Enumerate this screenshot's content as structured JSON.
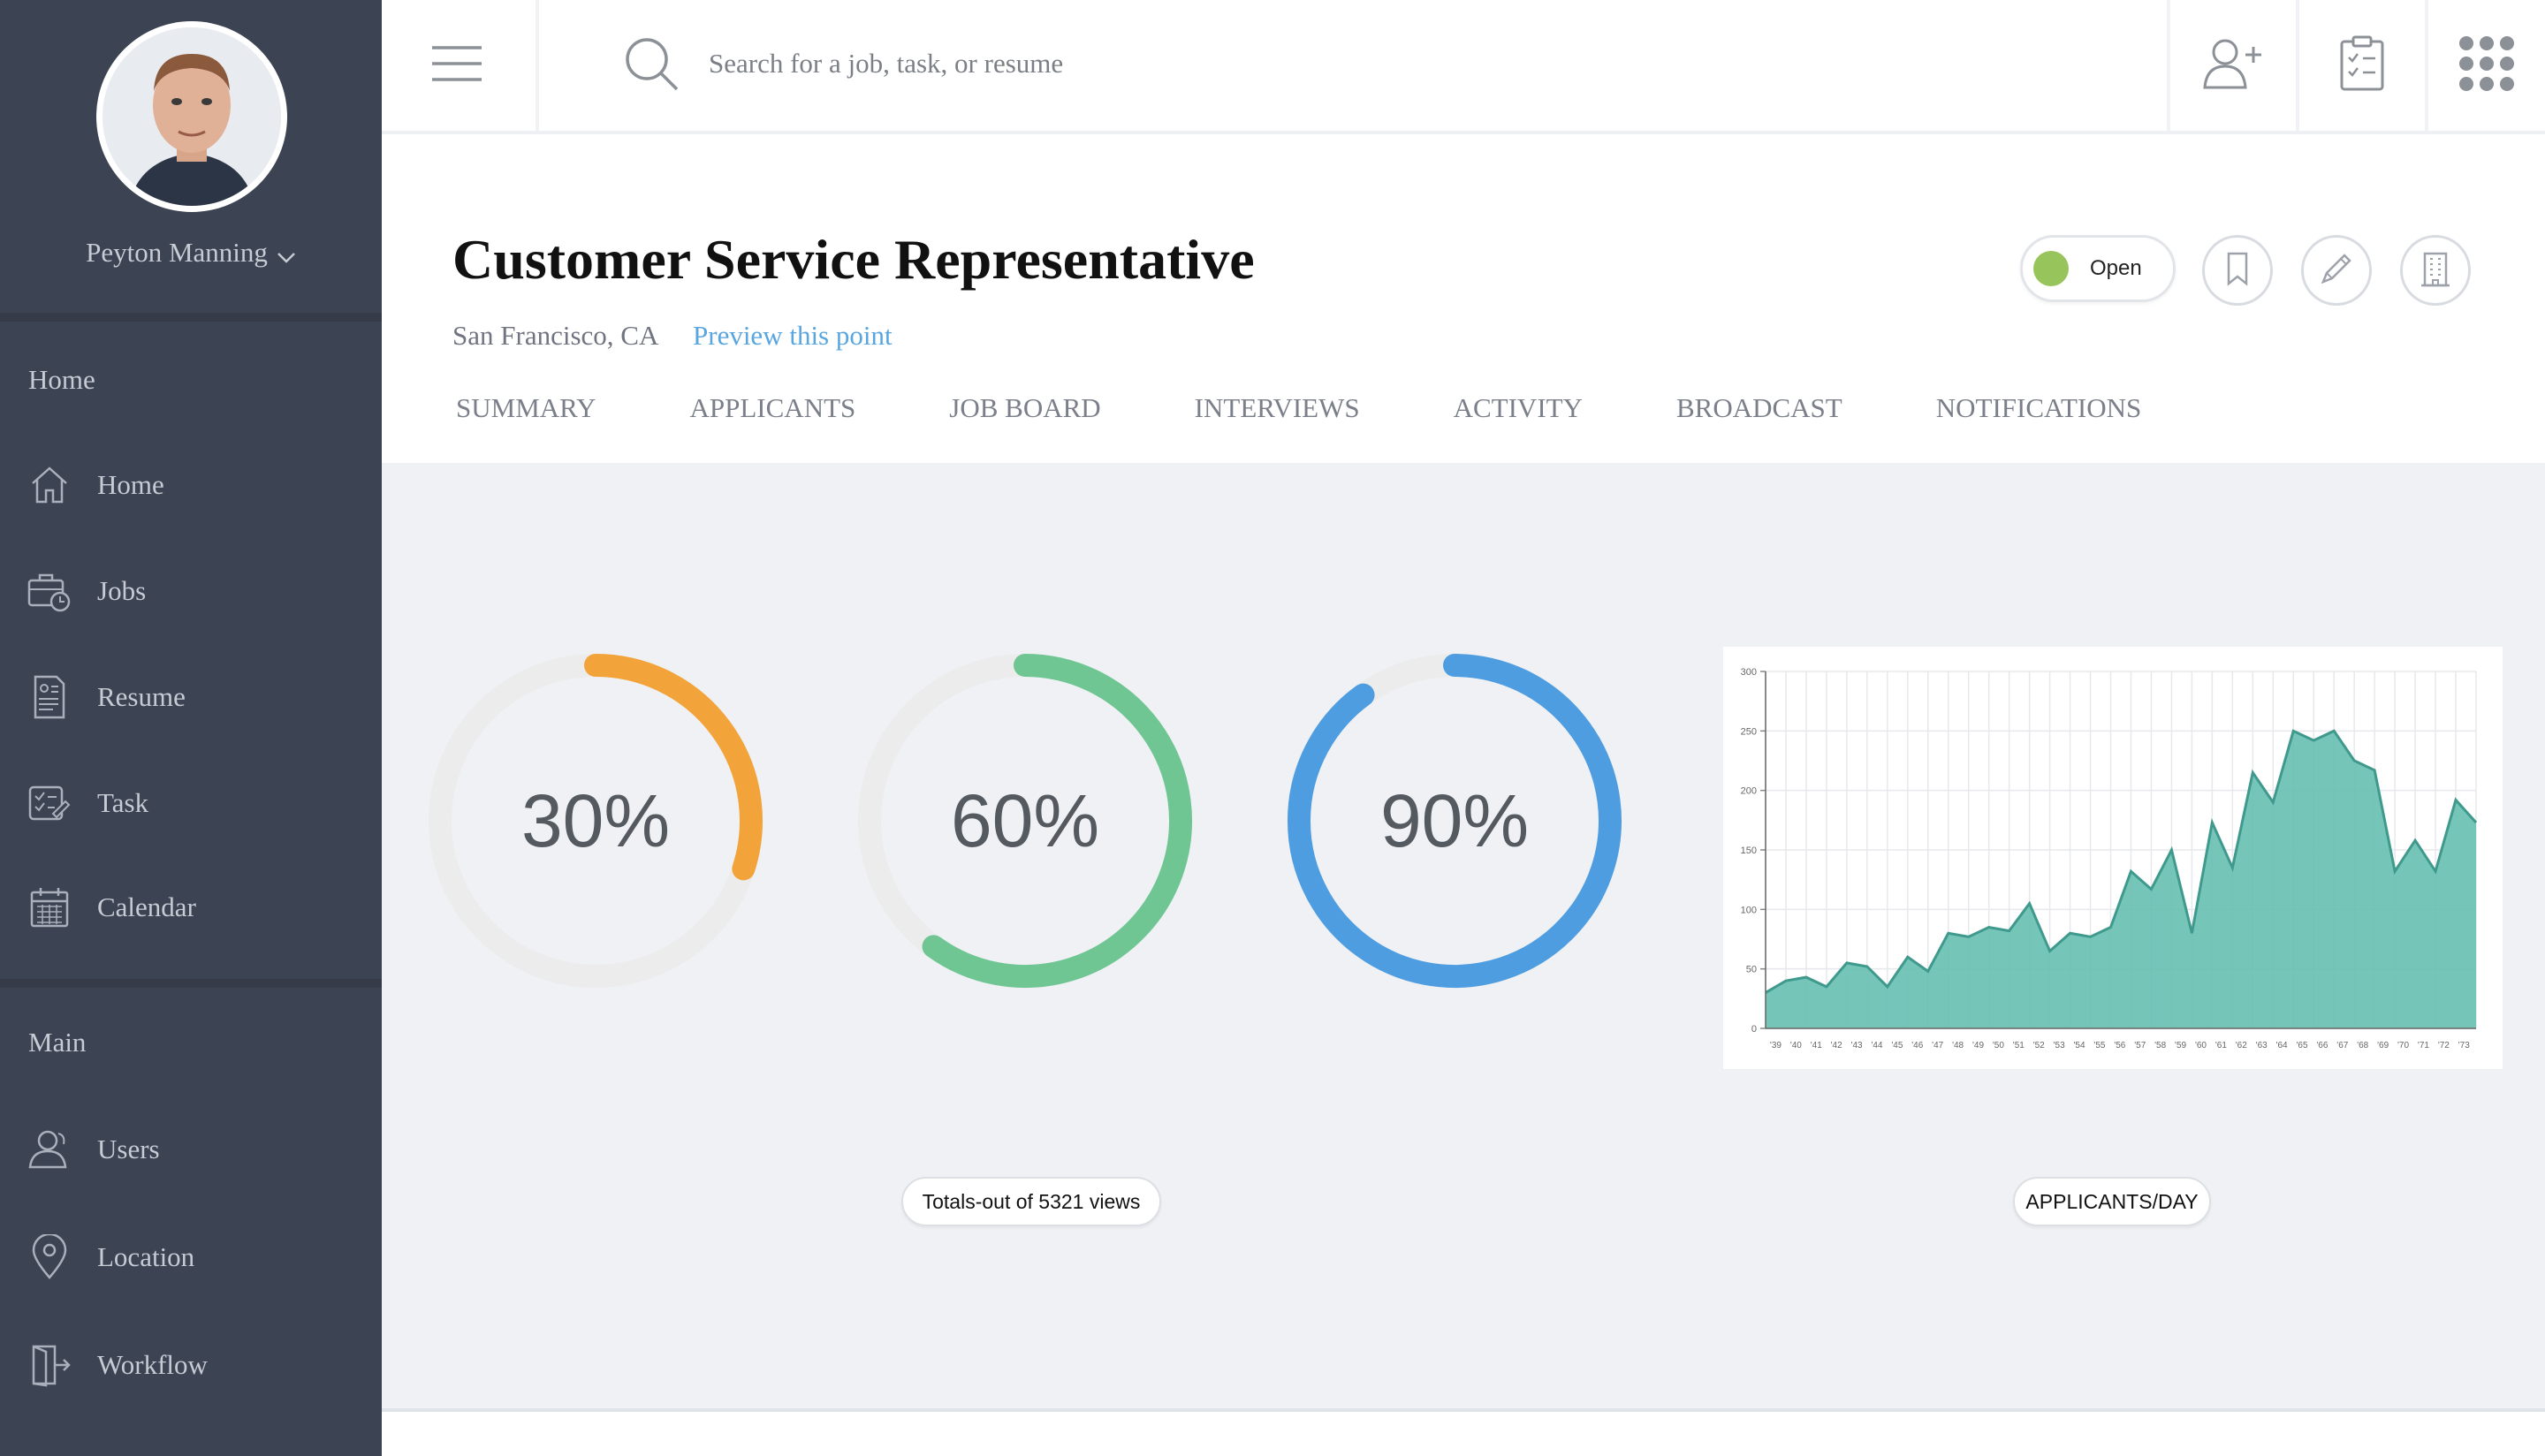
{
  "sidebar": {
    "user_name": "Peyton Manning",
    "sections": [
      {
        "title": "Home",
        "items": [
          {
            "label": "Home",
            "icon": "home-icon"
          },
          {
            "label": "Jobs",
            "icon": "briefcase-clock-icon"
          },
          {
            "label": "Resume",
            "icon": "resume-icon"
          },
          {
            "label": "Task",
            "icon": "task-icon"
          },
          {
            "label": "Calendar",
            "icon": "calendar-icon"
          }
        ]
      },
      {
        "title": "Main",
        "items": [
          {
            "label": "Users",
            "icon": "users-icon"
          },
          {
            "label": "Location",
            "icon": "location-pin-icon"
          },
          {
            "label": "Workflow",
            "icon": "workflow-icon"
          }
        ]
      }
    ]
  },
  "topbar": {
    "search_placeholder": "Search for a job, task, or resume",
    "icons": [
      "menu-icon",
      "search-icon",
      "add-user-icon",
      "clipboard-check-icon",
      "apps-grid-icon"
    ]
  },
  "job": {
    "title": "Customer Service Representative",
    "location": "San Francisco, CA",
    "preview_link": "Preview this point",
    "status": "Open",
    "status_color": "#98c55b",
    "action_icons": [
      "bookmark-icon",
      "pencil-icon",
      "building-icon"
    ]
  },
  "tabs": [
    "SUMMARY",
    "APPLICANTS",
    "JOB BOARD",
    "INTERVIEWS",
    "ACTIVITY",
    "BROADCAST",
    "NOTIFICATIONS"
  ],
  "stats": {
    "donuts": [
      {
        "label": "30%",
        "value": 30,
        "color": "#f2a43a"
      },
      {
        "label": "60%",
        "value": 60,
        "color": "#6fc693"
      },
      {
        "label": "90%",
        "value": 90,
        "color": "#4e9de0"
      }
    ],
    "donuts_caption": "Totals-out of 5321 views",
    "chart_caption": "APPLICANTS/DAY"
  },
  "chart_data": {
    "type": "area",
    "title": "",
    "xlabel": "",
    "ylabel": "",
    "ylim": [
      0,
      300
    ],
    "yticks": [
      0,
      50,
      100,
      150,
      200,
      250,
      300
    ],
    "x": [
      "'39",
      "'40",
      "'41",
      "'42",
      "'43",
      "'44",
      "'45",
      "'46",
      "'47",
      "'48",
      "'49",
      "'50",
      "'51",
      "'52",
      "'53",
      "'54",
      "'55",
      "'56",
      "'57",
      "'58",
      "'59",
      "'60",
      "'61",
      "'62",
      "'63",
      "'64",
      "'65",
      "'66",
      "'67",
      "'68",
      "'69",
      "'70",
      "'71",
      "'72",
      "'73"
    ],
    "series": [
      {
        "values": [
          30,
          40,
          43,
          35,
          55,
          52,
          35,
          60,
          48,
          80,
          77,
          85,
          82,
          105,
          65,
          80,
          77,
          85,
          132,
          117,
          150,
          80,
          173,
          135,
          215,
          190,
          250,
          242,
          250,
          225,
          217,
          132,
          158,
          132,
          192,
          173
        ],
        "color": "#67bfb1"
      }
    ],
    "grid": true,
    "legend": "none"
  }
}
